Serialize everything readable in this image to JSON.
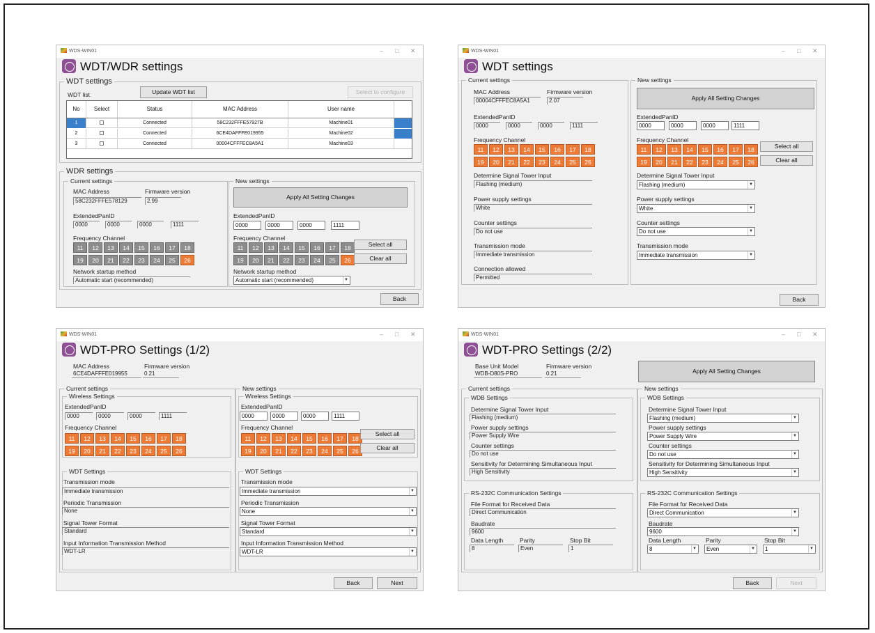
{
  "app_name": "WDS-WIN01",
  "w1": {
    "title": "WDT/WDR settings",
    "wdt_group": "WDT settings",
    "wdt_list_label": "WDT list",
    "update_button": "Update WDT list",
    "select_configure_button": "Select to configure",
    "columns": [
      "No",
      "Select",
      "Status",
      "MAC Address",
      "User name"
    ],
    "rows": [
      {
        "no": "1",
        "status": "Connected",
        "mac": "58C232FFFE57927B",
        "user": "Machine01"
      },
      {
        "no": "2",
        "status": "Connected",
        "mac": "6CE4DAFFFE019955",
        "user": "Machine02"
      },
      {
        "no": "3",
        "status": "Connected",
        "mac": "00004CFFFEC8A5A1",
        "user": "Machine03"
      }
    ],
    "wdr_group": "WDR settings",
    "current_group": "Current settings",
    "mac_label": "MAC Address",
    "fw_label": "Firmware version",
    "mac_value": "58C232FFFE578129",
    "fw_value": "2.99",
    "pan_label": "ExtendedPanID",
    "pan_current": [
      "0000",
      "0000",
      "0000",
      "1111"
    ],
    "freq_label": "Frequency Channel",
    "network_label": "Network startup method",
    "network_current": "Automatic start (recommended)",
    "new_group": "New settings",
    "apply_button": "Apply All Setting Changes",
    "pan_new": [
      "0000",
      "0000",
      "0000",
      "1111"
    ],
    "select_all": "Select all",
    "clear_all": "Clear all",
    "network_new": "Automatic start (recommended)",
    "back_button": "Back"
  },
  "w2": {
    "title": "WDT settings",
    "current_group": "Current settings",
    "new_group": "New settings",
    "mac_label": "MAC Address",
    "fw_label": "Firmware version",
    "mac_value": "00004CFFFEC8A5A1",
    "fw_value": "2.07",
    "pan_label": "ExtendedPanID",
    "pan_current": [
      "0000",
      "0000",
      "0000",
      "1111"
    ],
    "pan_new": [
      "0000",
      "0000",
      "0000",
      "1111"
    ],
    "freq_label": "Frequency Channel",
    "signal_label": "Determine Signal Tower Input",
    "signal_value": "Flashing (medium)",
    "power_label": "Power supply settings",
    "power_value": "White",
    "counter_label": "Counter settings",
    "counter_value": "Do not use",
    "trans_label": "Transmission mode",
    "trans_value": "Immediate transmission",
    "conn_label": "Connection allowed",
    "conn_value": "Permitted",
    "apply_button": "Apply All Setting Changes",
    "select_all": "Select all",
    "clear_all": "Clear all",
    "back_button": "Back"
  },
  "w3": {
    "title": "WDT-PRO Settings (1/2)",
    "mac_label": "MAC Address",
    "fw_label": "Firmware version",
    "mac_value": "6CE4DAFFFE019955",
    "fw_value": "0.21",
    "current_group": "Current settings",
    "new_group": "New settings",
    "wireless_group": "Wireless Settings",
    "pan_label": "ExtendedPanID",
    "pan_current": [
      "0000",
      "0000",
      "0000",
      "1111"
    ],
    "pan_new": [
      "0000",
      "0000",
      "0000",
      "1111"
    ],
    "freq_label": "Frequency Channel",
    "select_all": "Select all",
    "clear_all": "Clear all",
    "wdt_group": "WDT Settings",
    "trans_label": "Transmission mode",
    "trans_value": "Immediate transmission",
    "periodic_label": "Periodic Transmission",
    "periodic_value": "None",
    "format_label": "Signal Tower Format",
    "format_value": "Standard",
    "method_label": "Input Information Transmission Method",
    "method_value": "WDT-LR",
    "back_button": "Back",
    "next_button": "Next"
  },
  "w4": {
    "title": "WDT-PRO Settings (2/2)",
    "model_label": "Base Unit Model",
    "fw_label": "Firmware version",
    "model_value": "WDB-D80S-PRO",
    "fw_value": "0.21",
    "apply_button": "Apply All Setting Changes",
    "current_group": "Current settings",
    "new_group": "New settings",
    "wdb_group": "WDB Settings",
    "signal_label": "Determine Signal Tower Input",
    "signal_value": "Flashing (medium)",
    "power_label": "Power supply settings",
    "power_value": "Power Supply Wire",
    "counter_label": "Counter settings",
    "counter_value": "Do not use",
    "sens_label": "Sensitivity for Determining Simultaneous Input",
    "sens_value": "High Sensitivity",
    "rs_group": "RS-232C Communication Settings",
    "file_label": "File Format for Received Data",
    "file_value": "Direct Communication",
    "baud_label": "Baudrate",
    "baud_value": "9600",
    "len_label": "Data Length",
    "len_value": "8",
    "parity_label": "Parity",
    "parity_value": "Even",
    "stop_label": "Stop Bit",
    "stop_value": "1",
    "back_button": "Back",
    "next_button": "Next"
  },
  "channels": [
    "11",
    "12",
    "13",
    "14",
    "15",
    "16",
    "17",
    "18",
    "19",
    "20",
    "21",
    "22",
    "23",
    "24",
    "25",
    "26"
  ],
  "wdr_enabled_channels": [
    "26"
  ],
  "colors": {
    "channel_on": "#ed7b36",
    "channel_off": "#8d8d8d",
    "logo": "#8e4f95",
    "selected_row": "#3a7fc9"
  }
}
